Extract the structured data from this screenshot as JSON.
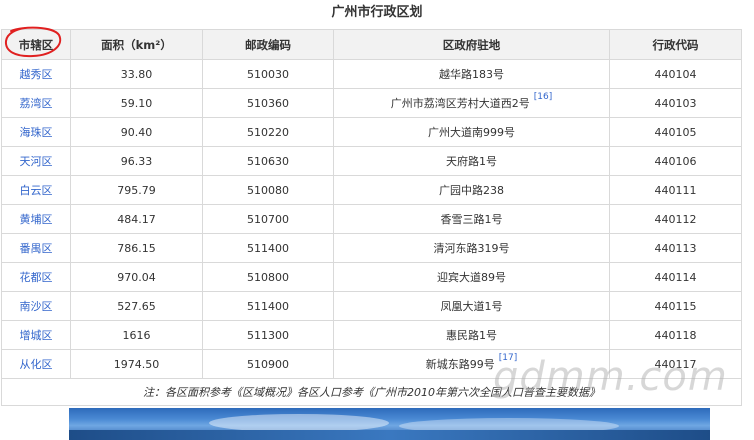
{
  "title": "广州市行政区划",
  "table": {
    "headers": [
      "市辖区",
      "面积（km²）",
      "邮政编码",
      "区政府驻地",
      "行政代码"
    ],
    "rows": [
      {
        "district": "越秀区",
        "area": "33.80",
        "postcode": "510030",
        "seat": "越华路183号",
        "ref": "",
        "code": "440104"
      },
      {
        "district": "荔湾区",
        "area": "59.10",
        "postcode": "510360",
        "seat": "广州市荔湾区芳村大道西2号",
        "ref": "[16]",
        "code": "440103"
      },
      {
        "district": "海珠区",
        "area": "90.40",
        "postcode": "510220",
        "seat": "广州大道南999号",
        "ref": "",
        "code": "440105"
      },
      {
        "district": "天河区",
        "area": "96.33",
        "postcode": "510630",
        "seat": "天府路1号",
        "ref": "",
        "code": "440106"
      },
      {
        "district": "白云区",
        "area": "795.79",
        "postcode": "510080",
        "seat": "广园中路238",
        "ref": "",
        "code": "440111"
      },
      {
        "district": "黄埔区",
        "area": "484.17",
        "postcode": "510700",
        "seat": "香雪三路1号",
        "ref": "",
        "code": "440112"
      },
      {
        "district": "番禺区",
        "area": "786.15",
        "postcode": "511400",
        "seat": "清河东路319号",
        "ref": "",
        "code": "440113"
      },
      {
        "district": "花都区",
        "area": "970.04",
        "postcode": "510800",
        "seat": "迎宾大道89号",
        "ref": "",
        "code": "440114"
      },
      {
        "district": "南沙区",
        "area": "527.65",
        "postcode": "511400",
        "seat": "凤凰大道1号",
        "ref": "",
        "code": "440115"
      },
      {
        "district": "增城区",
        "area": "1616",
        "postcode": "511300",
        "seat": "惠民路1号",
        "ref": "",
        "code": "440118"
      },
      {
        "district": "从化区",
        "area": "1974.50",
        "postcode": "510900",
        "seat": "新城东路99号",
        "ref": "[17]",
        "code": "440117"
      }
    ],
    "note": "注：各区面积参考《区域概况》各区人口参考《广州市2010年第六次全国人口普查主要数据》"
  },
  "watermark": "gdmm.com",
  "colors": {
    "link": "#3366cc",
    "header_bg": "#f2f2f2",
    "border": "#d9d9d9",
    "annotation": "#e02020"
  }
}
